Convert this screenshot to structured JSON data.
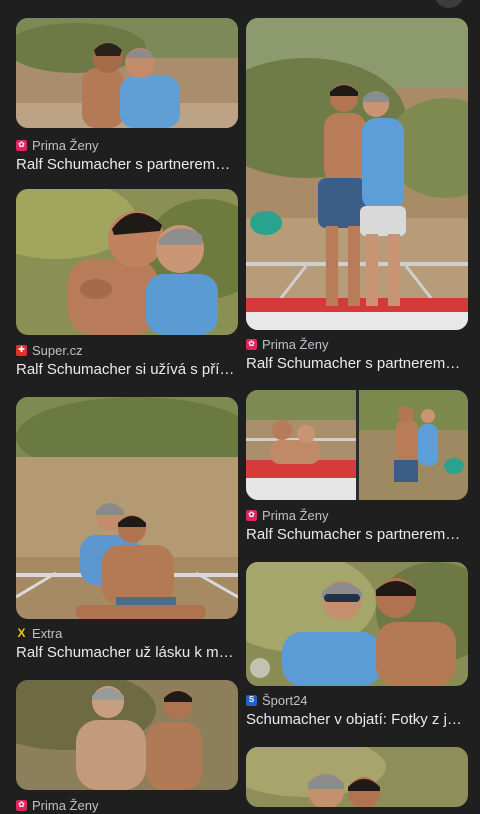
{
  "colors": {
    "background": "#1f1f1f",
    "title_text": "#e8eaed",
    "source_text": "#bdc1c6"
  },
  "results": [
    {
      "source": "Prima Ženy",
      "source_icon": "prima-zeny-icon",
      "title": "Ralf Schumacher s partnerem…"
    },
    {
      "source": "Prima Ženy",
      "source_icon": "prima-zeny-icon",
      "title": "Ralf Schumacher s partnerem…"
    },
    {
      "source": "Super.cz",
      "source_icon": "super-cz-icon",
      "title": "Ralf Schumacher si užívá s pří…"
    },
    {
      "source": "Prima Ženy",
      "source_icon": "prima-zeny-icon",
      "title": "Ralf Schumacher s partnerem…"
    },
    {
      "source": "Extra",
      "source_icon": "extra-icon",
      "title": "Ralf Schumacher už lásku k m…"
    },
    {
      "source": "Šport24",
      "source_icon": "sport24-icon",
      "title": "Schumacher v objatí: Fotky z j…"
    },
    {
      "source": "Prima Ženy",
      "source_icon": "prima-zeny-icon",
      "title": ""
    }
  ]
}
